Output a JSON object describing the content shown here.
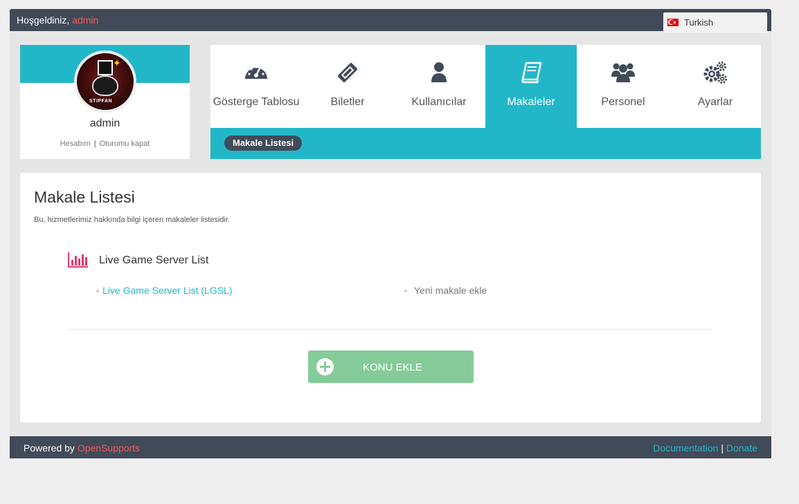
{
  "header": {
    "welcome_text": "Hoşgeldiniz,",
    "username": "admin",
    "language": "Turkish"
  },
  "profile": {
    "name": "admin",
    "avatar_text": "STIPFAN",
    "account_link": "Hesabım",
    "separator": "|",
    "logout_link": "Oturumu kapat"
  },
  "nav": {
    "tabs": [
      {
        "label": "Gösterge Tablosu",
        "icon": "dashboard-icon"
      },
      {
        "label": "Biletler",
        "icon": "ticket-icon"
      },
      {
        "label": "Kullanıcılar",
        "icon": "user-icon"
      },
      {
        "label": "Makaleler",
        "icon": "book-icon",
        "active": true
      },
      {
        "label": "Personel",
        "icon": "users-icon"
      },
      {
        "label": "Ayarlar",
        "icon": "cogs-icon"
      }
    ],
    "sub_item": "Makale Listesi"
  },
  "main": {
    "title": "Makale Listesi",
    "description": "Bu, hizmetlerimiz hakkında bilgi içeren makaleler listesidir.",
    "topic": {
      "title": "Live Game Server List",
      "icon": "bar-chart-icon",
      "articles": [
        "Live Game Server List (LGSL)"
      ],
      "add_article": "Yeni makale ekle"
    },
    "add_topic_button": "KONU EKLE"
  },
  "footer": {
    "powered_by": "Powered by",
    "brand": "OpenSupports",
    "documentation": "Documentation",
    "separator": "|",
    "donate": "Donate"
  },
  "colors": {
    "accent": "#22b7c8",
    "header_bg": "#414a59",
    "brand_red": "#f15a5a",
    "button_green": "#85cb99",
    "topic_icon": "#e5376b"
  }
}
